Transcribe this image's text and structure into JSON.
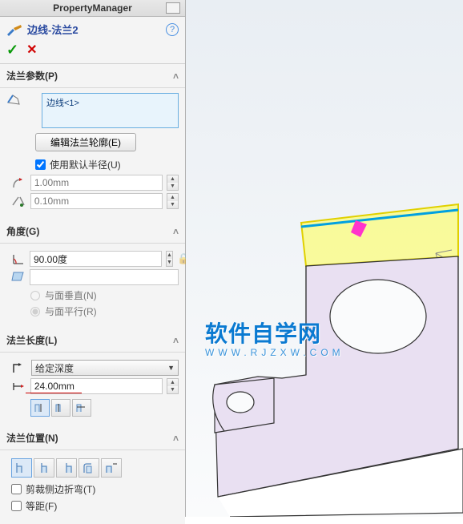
{
  "header": {
    "title": "PropertyManager"
  },
  "feature": {
    "title": "边线-法兰2"
  },
  "sections": {
    "flange_params": {
      "title": "法兰参数(P)",
      "edge_selected": "边线<1>",
      "edit_profile_btn": "编辑法兰轮廓(E)",
      "use_default_radius": "使用默认半径(U)",
      "radius_value": "1.00mm",
      "gap_value": "0.10mm"
    },
    "angle": {
      "title": "角度(G)",
      "value": "90.00度",
      "blank": "",
      "perpendicular": "与面垂直(N)",
      "parallel": "与面平行(R)"
    },
    "length": {
      "title": "法兰长度(L)",
      "end_condition": "给定深度",
      "value": "24.00mm"
    },
    "position": {
      "title": "法兰位置(N)",
      "trim_bends": "剪裁侧边折弯(T)",
      "equal_offset": "等距(F)"
    }
  },
  "watermark": {
    "main": "软件自学网",
    "sub": "WWW.RJZXW.COM"
  }
}
